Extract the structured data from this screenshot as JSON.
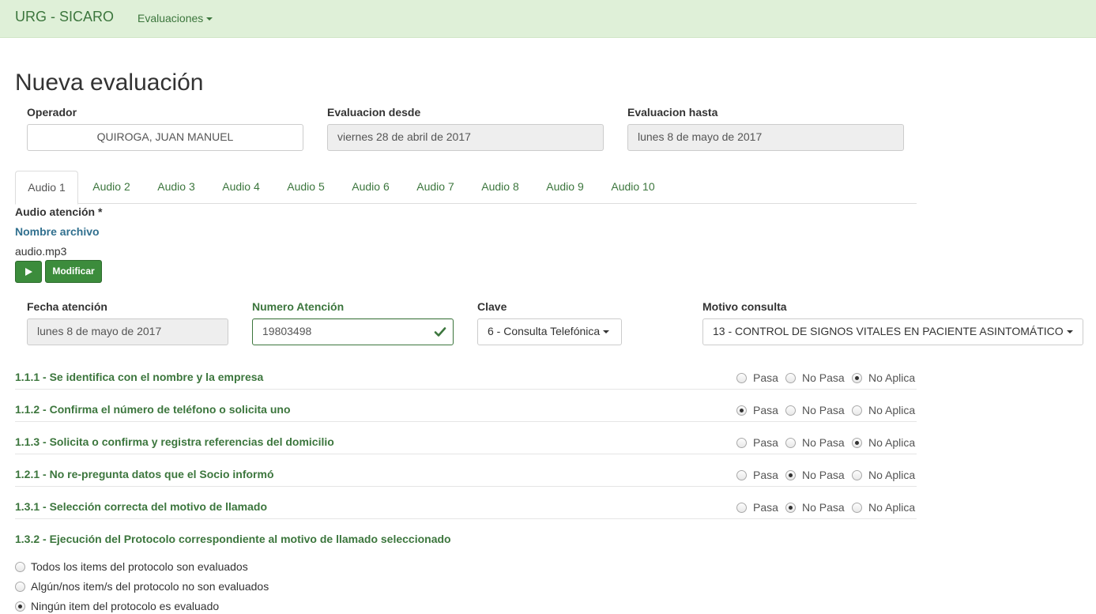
{
  "navbar": {
    "brand": "URG - SICARO",
    "menu_label": "Evaluaciones"
  },
  "page": {
    "title": "Nueva evaluación"
  },
  "header_fields": {
    "operador_label": "Operador",
    "operador_value": "QUIROGA, JUAN MANUEL",
    "desde_label": "Evaluacion desde",
    "desde_value": "viernes 28 de abril de 2017",
    "hasta_label": "Evaluacion hasta",
    "hasta_value": "lunes 8 de mayo de 2017"
  },
  "tabs": [
    "Audio 1",
    "Audio 2",
    "Audio 3",
    "Audio 4",
    "Audio 5",
    "Audio 6",
    "Audio 7",
    "Audio 8",
    "Audio 9",
    "Audio 10"
  ],
  "active_tab": 0,
  "audio": {
    "section_label": "Audio atención *",
    "file_header": "Nombre archivo",
    "file_name": "audio.mp3",
    "play_icon": "play-icon",
    "modify_label": "Modificar"
  },
  "attention": {
    "fecha_label": "Fecha atención",
    "fecha_value": "lunes 8 de mayo de 2017",
    "numero_label": "Numero Atención",
    "numero_value": "19803498",
    "clave_label": "Clave",
    "clave_value": "6 - Consulta Telefónica",
    "motivo_label": "Motivo consulta",
    "motivo_value": "13 - CONTROL DE SIGNOS VITALES EN PACIENTE ASINTOMÁTICO"
  },
  "radio_options": {
    "pasa": "Pasa",
    "no_pasa": "No Pasa",
    "no_aplica": "No Aplica"
  },
  "questions": [
    {
      "label": "1.1.1 - Se identifica con el nombre y la empresa",
      "selected": "no_aplica"
    },
    {
      "label": "1.1.2 - Confirma el número de teléfono o solicita uno",
      "selected": "pasa"
    },
    {
      "label": "1.1.3 - Solicita o confirma y registra referencias del domicilio",
      "selected": "no_aplica"
    },
    {
      "label": "1.2.1 - No re-pregunta datos que el Socio informó",
      "selected": "no_pasa"
    },
    {
      "label": "1.3.1 - Selección correcta del motivo de llamado",
      "selected": "no_pasa"
    }
  ],
  "protocol": {
    "label": "1.3.2 - Ejecución del Protocolo correspondiente al motivo de llamado seleccionado",
    "options": [
      "Todos los items del protocolo son evaluados",
      "Algún/nos item/s del protocolo no son evaluados",
      "Ningún item del protocolo es evaluado"
    ],
    "selected": 2
  },
  "colors": {
    "navbar_bg": "#dff0d8",
    "accent_green": "#3c763d",
    "button_green": "#3c8c3c",
    "label_blue": "#31708f"
  }
}
